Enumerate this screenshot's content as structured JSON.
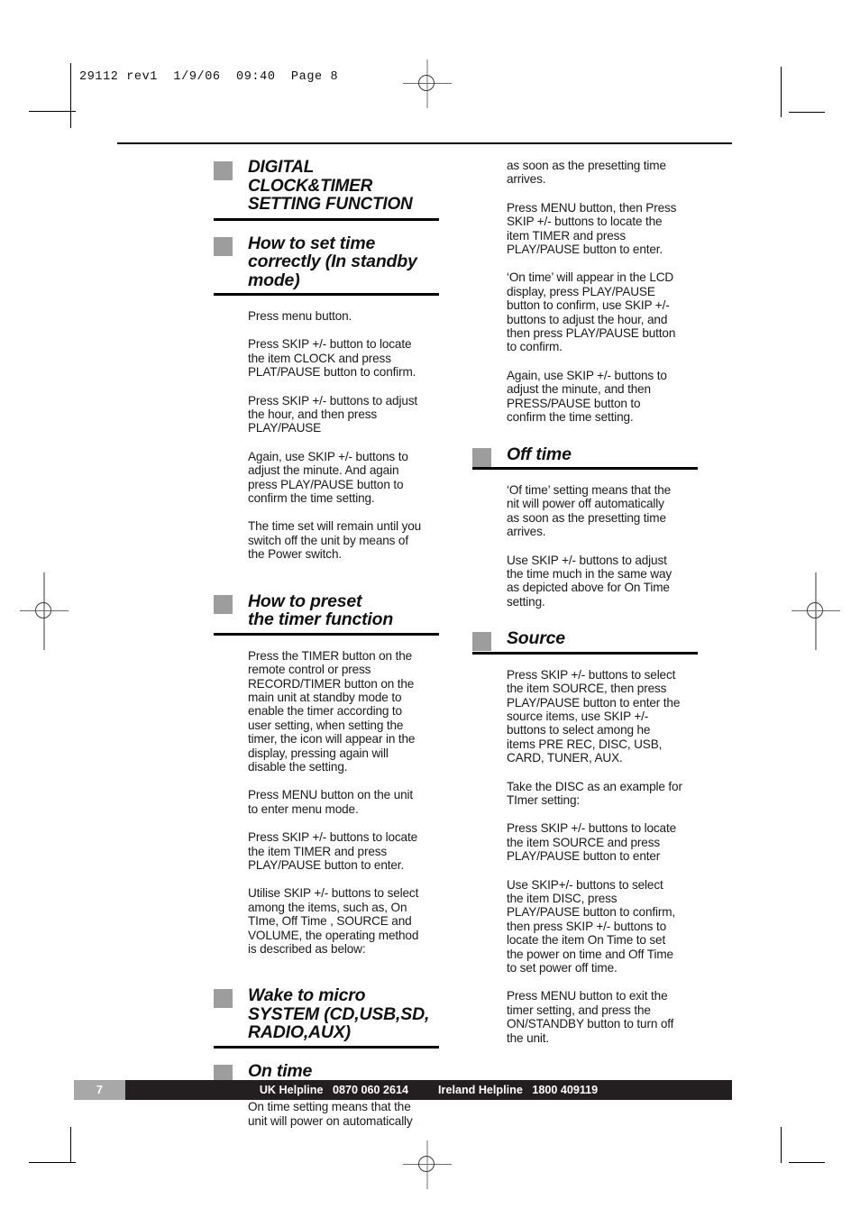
{
  "print_slug": "29112 rev1  1/9/06  09:40  Page 8",
  "colors": {
    "heading_bullet": "#9d9d9d",
    "footer_bar": "#231f20",
    "page_box": "#a8a8a8",
    "rule": "#000000",
    "text": "#1a1a1a"
  },
  "left_column": {
    "headings": {
      "digital_clock_timer": "DIGITAL\nCLOCK&TIMER\nSETTING FUNCTION",
      "how_to_set_time": "How to set time\ncorrectly (In standby\nmode)",
      "how_to_preset": "How to preset\nthe timer function",
      "wake_to_micro": "Wake to micro\nSYSTEM (CD,USB,SD,\nRADIO,AUX)",
      "on_time": "On time"
    },
    "paragraphs": {
      "p1": "Press menu button.",
      "p2": "Press SKIP +/- button to locate\nthe item CLOCK and press\nPLAT/PAUSE button to confirm.",
      "p3": "Press SKIP +/- buttons to adjust\nthe hour, and then press\nPLAY/PAUSE",
      "p4": "Again, use SKIP +/- buttons to\nadjust the minute. And again\npress PLAY/PAUSE button to\nconfirm the time setting.",
      "p5": "The time set will remain until you\nswitch off the unit by means of\nthe Power switch.",
      "p6": "Press the TIMER button on the\nremote control or press\nRECORD/TIMER button on the\nmain unit at standby mode to\nenable the timer according to\nuser setting, when setting the\ntimer, the icon will appear in the\ndisplay, pressing again will\ndisable the setting.",
      "p7": "Press MENU button on the unit\nto enter menu mode.",
      "p8": "Press SKIP +/- buttons to locate\nthe item TIMER and press\nPLAY/PAUSE button to enter.",
      "p9": "Utilise SKIP +/- buttons to select\namong the items, such as, On\nTIme, Off Time , SOURCE and\nVOLUME, the operating method\nis described as below:",
      "p10": "On time setting means that the\nunit will power on automatically"
    }
  },
  "right_column": {
    "headings": {
      "off_time": "Off time",
      "source": "Source"
    },
    "paragraphs": {
      "r1": "as soon as the presetting time\narrives.",
      "r2": "Press MENU button, then Press\nSKIP +/- buttons to locate the\nitem TIMER and press\nPLAY/PAUSE button to enter.",
      "r3": "‘On time’ will appear in the LCD\ndisplay, press PLAY/PAUSE\nbutton to confirm, use SKIP +/-\nbuttons to adjust the hour, and\nthen press PLAY/PAUSE button\nto confirm.",
      "r4": "Again, use SKIP +/- buttons to\nadjust the minute, and then\nPRESS/PAUSE button to\nconfirm the time setting.",
      "r5": "‘Of time’ setting means that the\nnit will power off automatically\nas soon as the presetting time\narrives.",
      "r6": "Use SKIP +/- buttons to adjust\nthe time much in the same way\nas depicted above for On Time\nsetting.",
      "r7": "Press SKIP +/- buttons to select\nthe item SOURCE, then press\nPLAY/PAUSE button to enter the\nsource items, use SKIP +/-\nbuttons to select among he\nitems PRE REC, DISC, USB,\nCARD, TUNER, AUX.",
      "r8": "Take the DISC as an example for\nTImer setting:",
      "r9": "Press SKIP +/- buttons to locate\nthe item SOURCE and press\nPLAY/PAUSE button to enter",
      "r10": "Use SKIP+/- buttons to select\nthe item DISC, press\nPLAY/PAUSE button to confirm,\nthen press SKIP +/- buttons to\nlocate the item On Time to set\nthe power on time and Off Time\nto set power off time.",
      "r11": "Press MENU button to exit the\ntimer setting, and press the\nON/STANDBY button to turn off\nthe unit."
    }
  },
  "footer": {
    "page_number": "7",
    "uk_label": "UK Helpline",
    "uk_number": "0870 060 2614",
    "ireland_label": "Ireland Helpline",
    "ireland_number": "1800 409119"
  }
}
